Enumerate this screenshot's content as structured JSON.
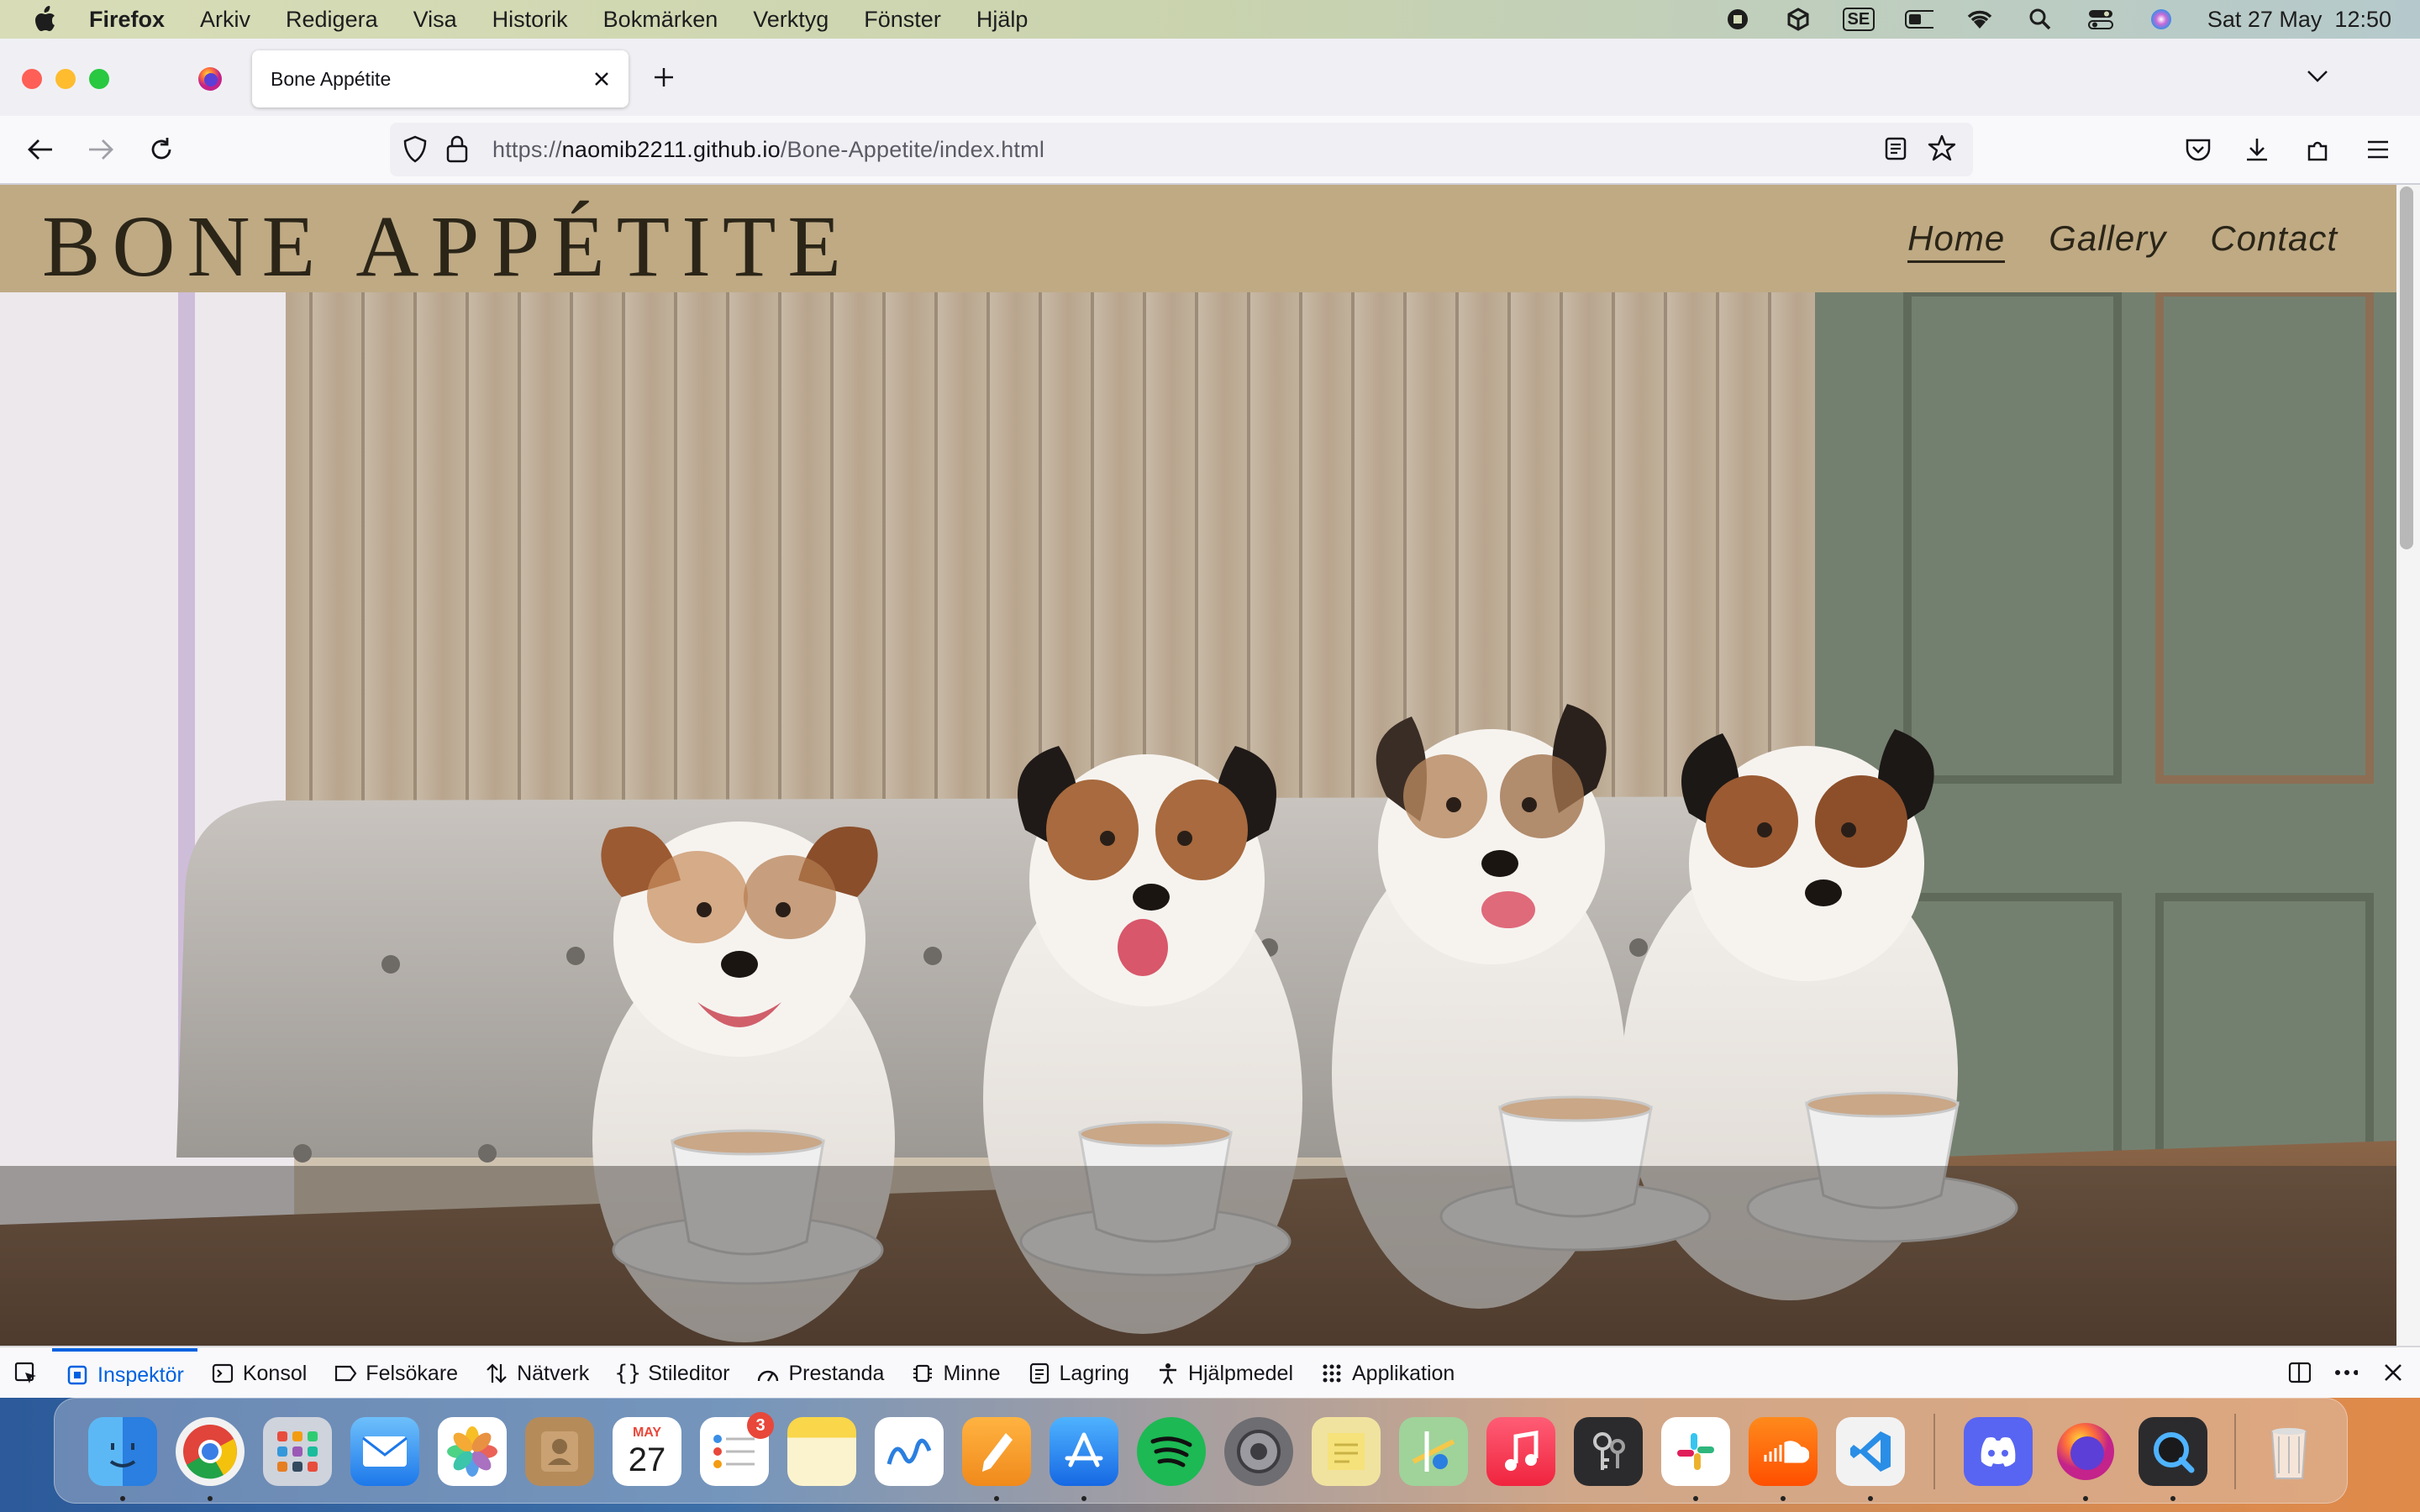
{
  "menubar": {
    "app_name": "Firefox",
    "menus": [
      "Arkiv",
      "Redigera",
      "Visa",
      "Historik",
      "Bokmärken",
      "Verktyg",
      "Fönster",
      "Hjälp"
    ],
    "keyboard_layout": "SE",
    "clock": "Sat 27 May  12:50"
  },
  "browser": {
    "tab_title": "Bone Appétite",
    "url_prefix": "https://",
    "url_domain": "naomib2211.github.io",
    "url_path": "/Bone-Appetite/index.html"
  },
  "site": {
    "logo": "BONE APPÉTITE",
    "nav": [
      "Home",
      "Gallery",
      "Contact"
    ],
    "active_nav": "Home",
    "colors": {
      "header_bg": "#bfaa84",
      "text": "#2b2518"
    }
  },
  "devtools": {
    "tabs": [
      "Inspektör",
      "Konsol",
      "Felsökare",
      "Nätverk",
      "Stileditor",
      "Prestanda",
      "Minne",
      "Lagring",
      "Hjälpmedel",
      "Applikation"
    ],
    "active_tab": "Inspektör",
    "accent": "#0061e0"
  },
  "dock": {
    "calendar_month": "MAY",
    "calendar_day": "27",
    "reminders_badge": "3"
  }
}
